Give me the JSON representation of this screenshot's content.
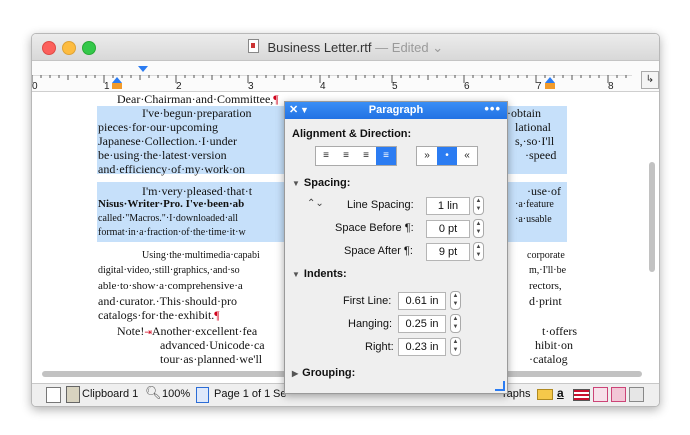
{
  "window": {
    "title": "Business Letter.rtf",
    "status": "— Edited ⌄"
  },
  "ruler": {
    "numbers": [
      "0",
      "1",
      "2",
      "3",
      "4",
      "5",
      "6",
      "7",
      "8"
    ],
    "corner": "↳"
  },
  "document": {
    "lines": [
      "Dear·Chairman·and·Committee,",
      "I've·begun·preparation",
      "pieces·for·our·upcoming",
      "Japanese·Collection.·I·under",
      "be·using·the·latest·version",
      "and·efficiency·of·my·work·on",
      "I'm·very·pleased·that·t",
      "Nisus·Writer·Pro. I've·been·ab",
      "called·\"Macros.\"·I·downloaded·all",
      "format·in·a·fraction·of·the·time·it·w",
      "Using·the·multimedia·capabi",
      "digital·video,·still·graphics,·and·so",
      "able·to·show·a·comprehensive·a",
      "and·curator.·This·should·pro",
      "catalogs·for·the·exhibit.",
      "Note!",
      "Another·excellent·fea",
      "advanced·Unicode·ca",
      "tour·as·planned·we'll",
      "·obtain",
      "lational",
      "s,·so·I'll",
      "·speed",
      "·use·of",
      "·a·feature",
      "·a·usable",
      "corporate",
      "m,·I'll·be",
      "rectors,",
      "d·print",
      "t·offers",
      "hibit·on",
      "·catalog"
    ],
    "pilcrow": "¶"
  },
  "statusbar": {
    "clipboard": "Clipboard 1",
    "zoom": "100%",
    "page": "Page 1 of 1",
    "trailing": "Se",
    "graphs": "raphs"
  },
  "palette": {
    "title": "Paragraph",
    "alignment_label": "Alignment & Direction:",
    "spacing_label": "Spacing:",
    "line_spacing_label": "Line Spacing:",
    "line_spacing_value": "1 lin",
    "space_before_label": "Space Before ¶:",
    "space_before_value": "0 pt",
    "space_after_label": "Space After ¶:",
    "space_after_value": "9 pt",
    "indents_label": "Indents:",
    "first_line_label": "First Line:",
    "first_line_value": "0.61 in",
    "hanging_label": "Hanging:",
    "hanging_value": "0.25 in",
    "right_label": "Right:",
    "right_value": "0.23 in",
    "grouping_label": "Grouping:"
  },
  "colors": {
    "selection": "#c6e0fa",
    "accent": "#2b7cf2",
    "pilcrow": "#d0021b"
  }
}
